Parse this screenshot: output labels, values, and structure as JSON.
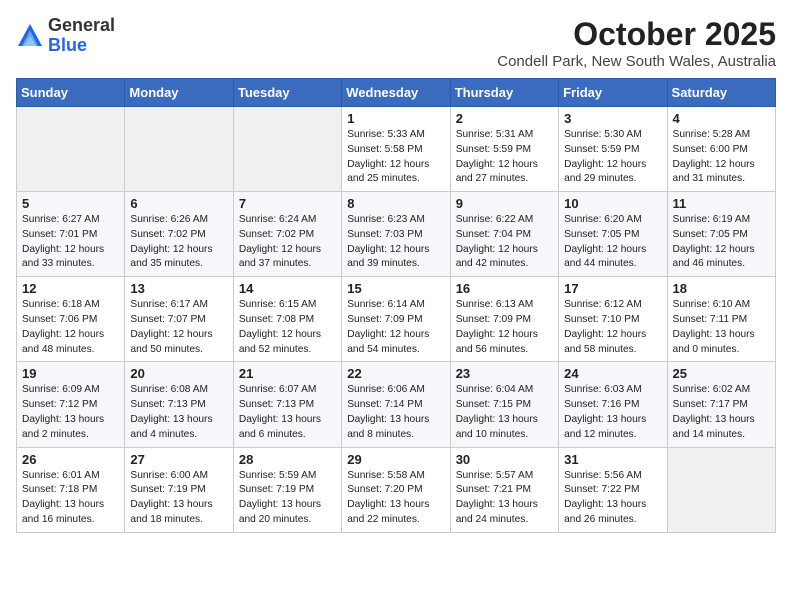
{
  "logo": {
    "general": "General",
    "blue": "Blue"
  },
  "header": {
    "month": "October 2025",
    "location": "Condell Park, New South Wales, Australia"
  },
  "weekdays": [
    "Sunday",
    "Monday",
    "Tuesday",
    "Wednesday",
    "Thursday",
    "Friday",
    "Saturday"
  ],
  "weeks": [
    [
      {
        "day": "",
        "sunrise": "",
        "sunset": "",
        "daylight": ""
      },
      {
        "day": "",
        "sunrise": "",
        "sunset": "",
        "daylight": ""
      },
      {
        "day": "",
        "sunrise": "",
        "sunset": "",
        "daylight": ""
      },
      {
        "day": "1",
        "sunrise": "Sunrise: 5:33 AM",
        "sunset": "Sunset: 5:58 PM",
        "daylight": "Daylight: 12 hours and 25 minutes."
      },
      {
        "day": "2",
        "sunrise": "Sunrise: 5:31 AM",
        "sunset": "Sunset: 5:59 PM",
        "daylight": "Daylight: 12 hours and 27 minutes."
      },
      {
        "day": "3",
        "sunrise": "Sunrise: 5:30 AM",
        "sunset": "Sunset: 5:59 PM",
        "daylight": "Daylight: 12 hours and 29 minutes."
      },
      {
        "day": "4",
        "sunrise": "Sunrise: 5:28 AM",
        "sunset": "Sunset: 6:00 PM",
        "daylight": "Daylight: 12 hours and 31 minutes."
      }
    ],
    [
      {
        "day": "5",
        "sunrise": "Sunrise: 6:27 AM",
        "sunset": "Sunset: 7:01 PM",
        "daylight": "Daylight: 12 hours and 33 minutes."
      },
      {
        "day": "6",
        "sunrise": "Sunrise: 6:26 AM",
        "sunset": "Sunset: 7:02 PM",
        "daylight": "Daylight: 12 hours and 35 minutes."
      },
      {
        "day": "7",
        "sunrise": "Sunrise: 6:24 AM",
        "sunset": "Sunset: 7:02 PM",
        "daylight": "Daylight: 12 hours and 37 minutes."
      },
      {
        "day": "8",
        "sunrise": "Sunrise: 6:23 AM",
        "sunset": "Sunset: 7:03 PM",
        "daylight": "Daylight: 12 hours and 39 minutes."
      },
      {
        "day": "9",
        "sunrise": "Sunrise: 6:22 AM",
        "sunset": "Sunset: 7:04 PM",
        "daylight": "Daylight: 12 hours and 42 minutes."
      },
      {
        "day": "10",
        "sunrise": "Sunrise: 6:20 AM",
        "sunset": "Sunset: 7:05 PM",
        "daylight": "Daylight: 12 hours and 44 minutes."
      },
      {
        "day": "11",
        "sunrise": "Sunrise: 6:19 AM",
        "sunset": "Sunset: 7:05 PM",
        "daylight": "Daylight: 12 hours and 46 minutes."
      }
    ],
    [
      {
        "day": "12",
        "sunrise": "Sunrise: 6:18 AM",
        "sunset": "Sunset: 7:06 PM",
        "daylight": "Daylight: 12 hours and 48 minutes."
      },
      {
        "day": "13",
        "sunrise": "Sunrise: 6:17 AM",
        "sunset": "Sunset: 7:07 PM",
        "daylight": "Daylight: 12 hours and 50 minutes."
      },
      {
        "day": "14",
        "sunrise": "Sunrise: 6:15 AM",
        "sunset": "Sunset: 7:08 PM",
        "daylight": "Daylight: 12 hours and 52 minutes."
      },
      {
        "day": "15",
        "sunrise": "Sunrise: 6:14 AM",
        "sunset": "Sunset: 7:09 PM",
        "daylight": "Daylight: 12 hours and 54 minutes."
      },
      {
        "day": "16",
        "sunrise": "Sunrise: 6:13 AM",
        "sunset": "Sunset: 7:09 PM",
        "daylight": "Daylight: 12 hours and 56 minutes."
      },
      {
        "day": "17",
        "sunrise": "Sunrise: 6:12 AM",
        "sunset": "Sunset: 7:10 PM",
        "daylight": "Daylight: 12 hours and 58 minutes."
      },
      {
        "day": "18",
        "sunrise": "Sunrise: 6:10 AM",
        "sunset": "Sunset: 7:11 PM",
        "daylight": "Daylight: 13 hours and 0 minutes."
      }
    ],
    [
      {
        "day": "19",
        "sunrise": "Sunrise: 6:09 AM",
        "sunset": "Sunset: 7:12 PM",
        "daylight": "Daylight: 13 hours and 2 minutes."
      },
      {
        "day": "20",
        "sunrise": "Sunrise: 6:08 AM",
        "sunset": "Sunset: 7:13 PM",
        "daylight": "Daylight: 13 hours and 4 minutes."
      },
      {
        "day": "21",
        "sunrise": "Sunrise: 6:07 AM",
        "sunset": "Sunset: 7:13 PM",
        "daylight": "Daylight: 13 hours and 6 minutes."
      },
      {
        "day": "22",
        "sunrise": "Sunrise: 6:06 AM",
        "sunset": "Sunset: 7:14 PM",
        "daylight": "Daylight: 13 hours and 8 minutes."
      },
      {
        "day": "23",
        "sunrise": "Sunrise: 6:04 AM",
        "sunset": "Sunset: 7:15 PM",
        "daylight": "Daylight: 13 hours and 10 minutes."
      },
      {
        "day": "24",
        "sunrise": "Sunrise: 6:03 AM",
        "sunset": "Sunset: 7:16 PM",
        "daylight": "Daylight: 13 hours and 12 minutes."
      },
      {
        "day": "25",
        "sunrise": "Sunrise: 6:02 AM",
        "sunset": "Sunset: 7:17 PM",
        "daylight": "Daylight: 13 hours and 14 minutes."
      }
    ],
    [
      {
        "day": "26",
        "sunrise": "Sunrise: 6:01 AM",
        "sunset": "Sunset: 7:18 PM",
        "daylight": "Daylight: 13 hours and 16 minutes."
      },
      {
        "day": "27",
        "sunrise": "Sunrise: 6:00 AM",
        "sunset": "Sunset: 7:19 PM",
        "daylight": "Daylight: 13 hours and 18 minutes."
      },
      {
        "day": "28",
        "sunrise": "Sunrise: 5:59 AM",
        "sunset": "Sunset: 7:19 PM",
        "daylight": "Daylight: 13 hours and 20 minutes."
      },
      {
        "day": "29",
        "sunrise": "Sunrise: 5:58 AM",
        "sunset": "Sunset: 7:20 PM",
        "daylight": "Daylight: 13 hours and 22 minutes."
      },
      {
        "day": "30",
        "sunrise": "Sunrise: 5:57 AM",
        "sunset": "Sunset: 7:21 PM",
        "daylight": "Daylight: 13 hours and 24 minutes."
      },
      {
        "day": "31",
        "sunrise": "Sunrise: 5:56 AM",
        "sunset": "Sunset: 7:22 PM",
        "daylight": "Daylight: 13 hours and 26 minutes."
      },
      {
        "day": "",
        "sunrise": "",
        "sunset": "",
        "daylight": ""
      }
    ]
  ]
}
